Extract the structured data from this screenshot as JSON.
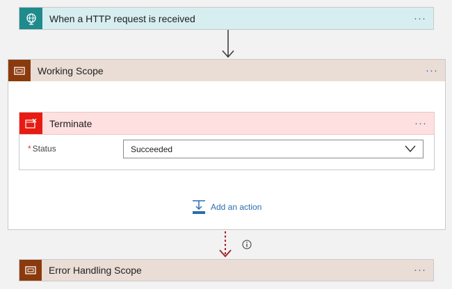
{
  "trigger": {
    "title": "When a HTTP request is received",
    "menu": "···",
    "icon": "globe-request-icon"
  },
  "working_scope": {
    "title": "Working Scope",
    "menu": "···",
    "icon": "scope-icon"
  },
  "terminate": {
    "title": "Terminate",
    "menu": "···",
    "icon": "terminate-icon",
    "status_required_marker": "*",
    "status_label": "Status",
    "status_value": "Succeeded"
  },
  "add_action": {
    "label": "Add an action",
    "icon": "add-action-icon"
  },
  "error_scope": {
    "title": "Error Handling Scope",
    "menu": "···",
    "icon": "scope-icon"
  },
  "colors": {
    "trigger_accent": "#1f8b8d",
    "scope_accent": "#8b3a0e",
    "terminate_accent": "#e81b12",
    "link_blue": "#2b6cb0",
    "failed_arrow": "#a4262c"
  }
}
